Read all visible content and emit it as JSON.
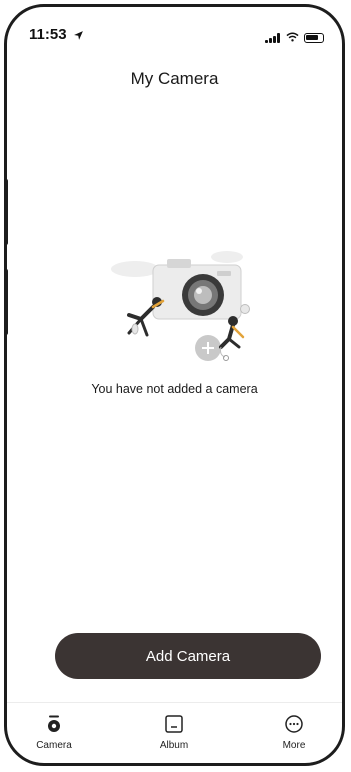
{
  "status_bar": {
    "time": "11:53",
    "icons": [
      "location-arrow-icon",
      "signal-icon",
      "wifi-icon",
      "battery-icon"
    ]
  },
  "header": {
    "title": "My Camera"
  },
  "empty_state": {
    "message": "You have not added a camera",
    "illustration": "camera-illustration"
  },
  "actions": {
    "add_camera_label": "Add Camera"
  },
  "tabbar": {
    "items": [
      {
        "label": "Camera",
        "icon": "camera-tab-icon",
        "active": true
      },
      {
        "label": "Album",
        "icon": "album-tab-icon",
        "active": false
      },
      {
        "label": "More",
        "icon": "more-tab-icon",
        "active": false
      }
    ]
  },
  "colors": {
    "button_bg": "#3b3433",
    "button_text": "#ffffff",
    "text": "#1a1a1a"
  }
}
